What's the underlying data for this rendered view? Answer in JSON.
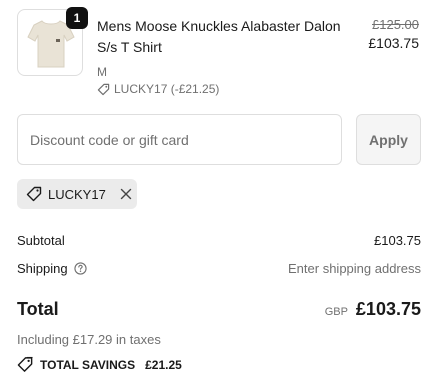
{
  "product": {
    "quantity": "1",
    "name": "Mens Moose Knuckles Alabaster Dalon S/s T Shirt",
    "variant": "M",
    "discount": "LUCKY17 (-£21.25)",
    "original_price": "£125.00",
    "price": "£103.75"
  },
  "discount_form": {
    "placeholder": "Discount code or gift card",
    "apply_label": "Apply"
  },
  "applied_code": {
    "code": "LUCKY17"
  },
  "summary": {
    "subtotal_label": "Subtotal",
    "subtotal_value": "£103.75",
    "shipping_label": "Shipping",
    "shipping_value": "Enter shipping address",
    "total_label": "Total",
    "currency": "GBP",
    "total_value": "£103.75",
    "tax_text": "Including £17.29 in taxes",
    "savings_label": "TOTAL SAVINGS",
    "savings_value": "£21.25"
  },
  "icons": {
    "tag": "tag-icon",
    "close": "close-icon",
    "help": "help-icon",
    "savings_tag": "savings-tag-icon"
  }
}
